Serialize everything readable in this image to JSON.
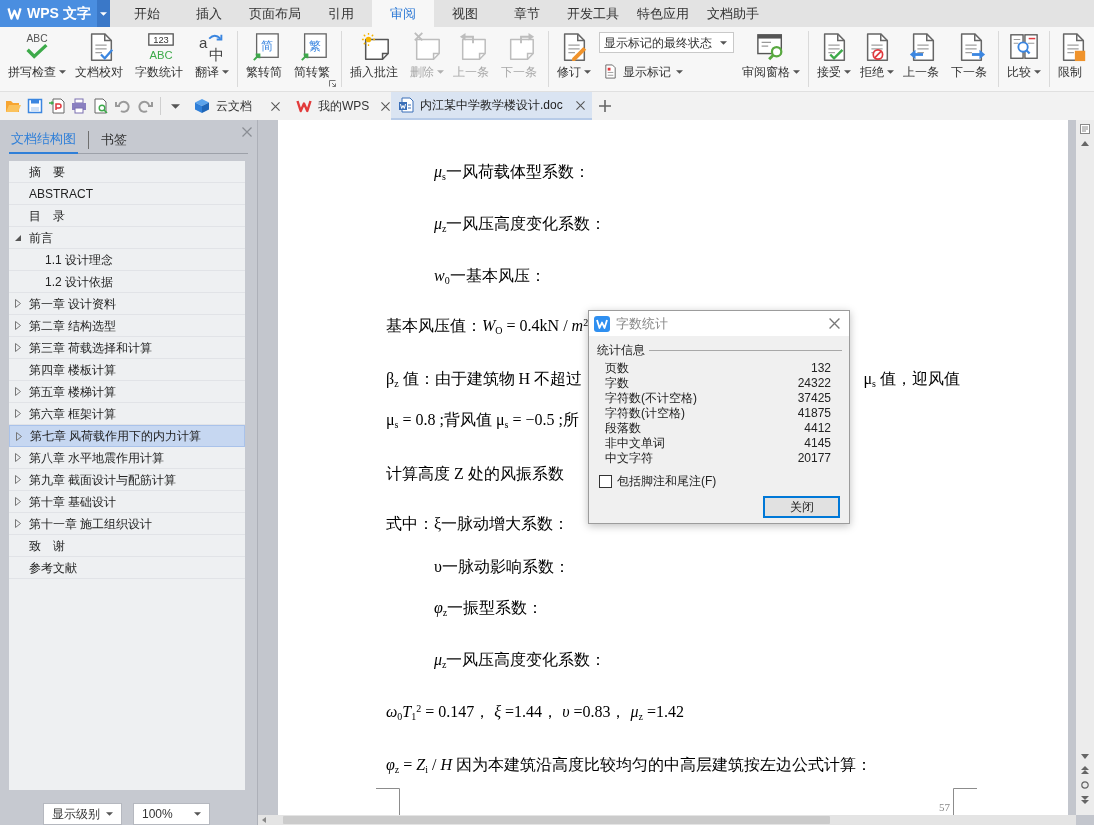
{
  "app_button": {
    "label": "WPS 文字"
  },
  "menu_tabs": [
    {
      "label": "开始",
      "selected": false
    },
    {
      "label": "插入",
      "selected": false
    },
    {
      "label": "页面布局",
      "selected": false
    },
    {
      "label": "引用",
      "selected": false
    },
    {
      "label": "审阅",
      "selected": true
    },
    {
      "label": "视图",
      "selected": false
    },
    {
      "label": "章节",
      "selected": false
    },
    {
      "label": "开发工具",
      "selected": false
    },
    {
      "label": "特色应用",
      "selected": false
    },
    {
      "label": "文档助手",
      "selected": false
    }
  ],
  "ribbon": {
    "groups": [
      {
        "items": [
          {
            "kind": "large",
            "label": "拼写检查",
            "icon_text": [
              "ABC"
            ],
            "dropdown": true,
            "disabled": false
          },
          {
            "kind": "large",
            "label": "文档校对",
            "dropdown": false,
            "disabled": false
          },
          {
            "kind": "large",
            "label": "字数统计",
            "icon_text": [
              "123",
              "ABC"
            ],
            "dropdown": false,
            "disabled": false
          },
          {
            "kind": "large",
            "label": "翻译",
            "icon_text": [
              "a",
              "中"
            ],
            "dropdown": true,
            "disabled": false
          }
        ]
      },
      {
        "items": [
          {
            "kind": "large",
            "label": "繁转简",
            "icon_text": [
              "简"
            ],
            "dropdown": false,
            "disabled": false
          },
          {
            "kind": "large",
            "label": "简转繁",
            "icon_text": [
              "繁"
            ],
            "dropdown": false,
            "disabled": false
          }
        ]
      },
      {
        "items": [
          {
            "kind": "large",
            "label": "插入批注",
            "dropdown": false,
            "disabled": false
          },
          {
            "kind": "large",
            "label": "删除",
            "dropdown": true,
            "disabled": true
          },
          {
            "kind": "large",
            "label": "上一条",
            "dropdown": false,
            "disabled": true
          },
          {
            "kind": "large",
            "label": "下一条",
            "dropdown": false,
            "disabled": true
          }
        ]
      },
      {
        "items": [
          {
            "kind": "large",
            "label": "修订",
            "dropdown": true,
            "disabled": false
          },
          {
            "kind": "stack",
            "items": [
              {
                "kind": "select",
                "value": "显示标记的最终状态"
              },
              {
                "kind": "small",
                "label": "显示标记",
                "dropdown": true,
                "disabled": false
              }
            ]
          },
          {
            "kind": "large",
            "label": "审阅窗格",
            "dropdown": true,
            "disabled": false
          }
        ]
      },
      {
        "items": [
          {
            "kind": "large",
            "label": "接受",
            "dropdown": true,
            "disabled": false
          },
          {
            "kind": "large",
            "label": "拒绝",
            "dropdown": true,
            "disabled": false
          },
          {
            "kind": "large",
            "label": "上一条",
            "dropdown": false,
            "disabled": false
          },
          {
            "kind": "large",
            "label": "下一条",
            "dropdown": false,
            "disabled": false
          }
        ]
      },
      {
        "items": [
          {
            "kind": "large",
            "label": "比较",
            "dropdown": true,
            "disabled": false
          }
        ]
      },
      {
        "items": [
          {
            "kind": "large",
            "label": "限制",
            "dropdown": false,
            "disabled": false
          }
        ]
      }
    ]
  },
  "doc_tabs": [
    {
      "label": "云文档",
      "selected": false
    },
    {
      "label": "我的WPS",
      "selected": false
    },
    {
      "label": "内江某中学教学楼设计.doc",
      "selected": true
    }
  ],
  "sidebar": {
    "tabs": [
      {
        "label": "文档结构图",
        "selected": true
      },
      {
        "label": "书签",
        "selected": false
      }
    ],
    "outline": [
      {
        "label": "摘　要",
        "selected": false
      },
      {
        "label": "ABSTRACT",
        "selected": false
      },
      {
        "label": "目　录",
        "selected": false
      },
      {
        "label": "前言",
        "selected": false,
        "expanded": true,
        "children": [
          {
            "label": "1.1 设计理念",
            "selected": false
          },
          {
            "label": "1.2 设计依据",
            "selected": false
          }
        ]
      },
      {
        "label": "第一章 设计资料",
        "selected": false,
        "expanded": false
      },
      {
        "label": "第二章 结构选型",
        "selected": false,
        "expanded": false
      },
      {
        "label": "第三章 荷载选择和计算",
        "selected": false,
        "expanded": false
      },
      {
        "label": "第四章 楼板计算",
        "selected": false
      },
      {
        "label": "第五章 楼梯计算",
        "selected": false,
        "expanded": false
      },
      {
        "label": "第六章 框架计算",
        "selected": false,
        "expanded": false
      },
      {
        "label": "第七章 风荷载作用下的内力计算",
        "selected": true,
        "expanded": false
      },
      {
        "label": "第八章 水平地震作用计算",
        "selected": false,
        "expanded": false
      },
      {
        "label": "第九章 截面设计与配筋计算",
        "selected": false,
        "expanded": false
      },
      {
        "label": "第十章 基础设计",
        "selected": false,
        "expanded": false
      },
      {
        "label": "第十一章 施工组织设计",
        "selected": false,
        "expanded": false
      },
      {
        "label": "致　谢",
        "selected": false
      },
      {
        "label": "参考文献",
        "selected": false
      }
    ],
    "controls": [
      {
        "value": "显示级别"
      },
      {
        "value": "100%"
      }
    ]
  },
  "document": {
    "lines": [
      {
        "kind": "definition",
        "text": "*μ*$_{s}$一风荷载体型系数："
      },
      {
        "kind": "definition",
        "text": "*μ*$_{z}$一风压高度变化系数："
      },
      {
        "kind": "definition",
        "text": "*w*$_{0}$一基本风压："
      },
      {
        "kind": "paragraph",
        "text": "基本风压值：*W*$_{O}$ = 0.4kN / *m*$^{2}$"
      },
      {
        "kind": "paragraph",
        "text": "β$_{z}$ 值：由于建筑物 H 不超过",
        "text_right": "μ$_{s}$ 值，迎风值"
      },
      {
        "kind": "paragraph",
        "text": "μ$_{s}$ = 0.8 ;背风值 μ$_{s}$ = −0.5 ;所"
      },
      {
        "kind": "paragraph",
        "text": "计算高度 Z 处的风振系数"
      },
      {
        "kind": "paragraph",
        "text": "式中：ξ一脉动增大系数："
      },
      {
        "kind": "definition",
        "text": "υ一脉动影响系数："
      },
      {
        "kind": "definition",
        "text": "*φ*$_{z}$一振型系数："
      },
      {
        "kind": "definition",
        "text": "*μ*$_{z}$一风压高度变化系数："
      },
      {
        "kind": "paragraph",
        "text": "*ω*$_{0}$*T*$_{1}$$^{2}$ = 0.147， *ξ* =1.44， *υ* =0.83， *μ*$_{z}$ =1.42"
      },
      {
        "kind": "paragraph",
        "text": "*φ*$_{z}$ = *Z*$_{i}$ / *H* 因为本建筑沿高度比较均匀的中高层建筑按左边公式计算："
      }
    ],
    "page_number": "57"
  },
  "dialog": {
    "title": "字数统计",
    "group_label": "统计信息",
    "stats": [
      {
        "label": "页数",
        "value": "132"
      },
      {
        "label": "字数",
        "value": "24322"
      },
      {
        "label": "字符数(不计空格)",
        "value": "37425"
      },
      {
        "label": "字符数(计空格)",
        "value": "41875"
      },
      {
        "label": "段落数",
        "value": "4412"
      },
      {
        "label": "非中文单词",
        "value": "4145"
      },
      {
        "label": "中文字符",
        "value": "20177"
      }
    ],
    "checkbox": {
      "label": "包括脚注和尾注(F)",
      "checked": false
    },
    "button": "关闭"
  }
}
